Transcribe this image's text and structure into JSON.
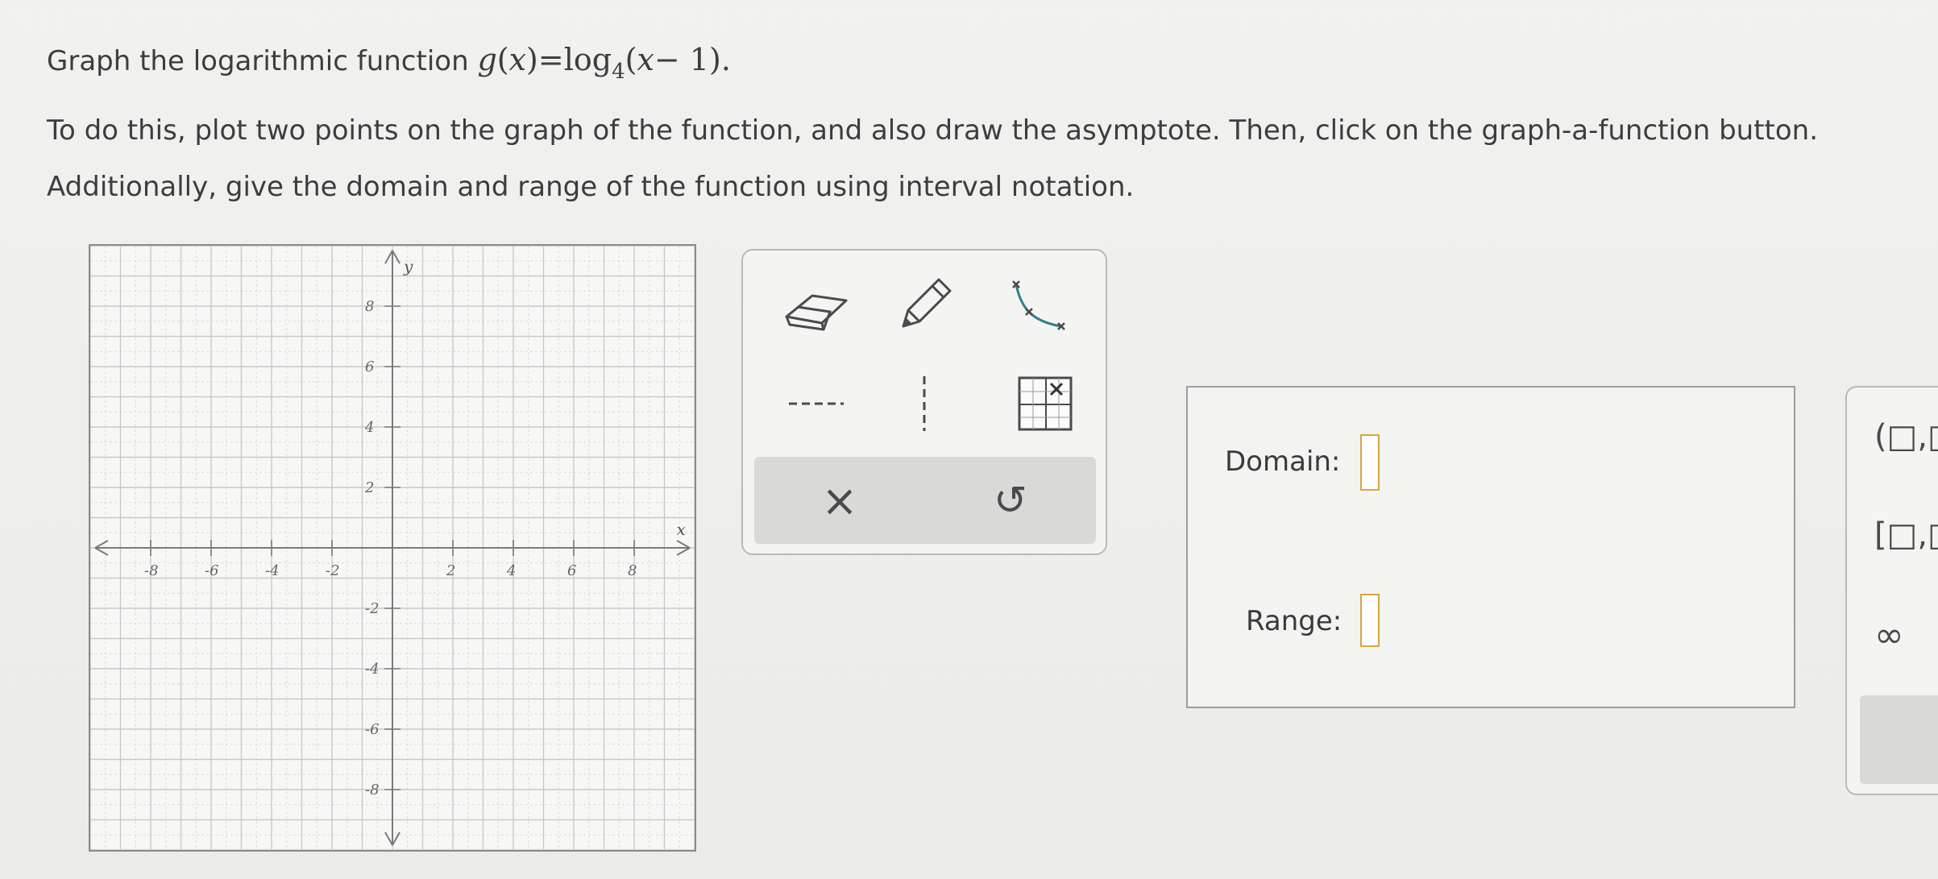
{
  "prompt": {
    "line1_prefix": "Graph the logarithmic function",
    "func_lhs": "g",
    "func_var": "x",
    "func_log": "log",
    "func_base": "4",
    "func_arg": "x",
    "func_minus": "− 1",
    "line2": "To do this, plot two points on the graph of the function, and also draw the asymptote. Then, click on the graph-a-function button.",
    "line3": "Additionally, give the domain and range of the function using interval notation."
  },
  "graph": {
    "x_axis_label": "x",
    "y_axis_label": "y",
    "x_range": [
      -10,
      10
    ],
    "y_range": [
      -10,
      10
    ],
    "x_tick_labels": [
      "-8",
      "-6",
      "-4",
      "-2",
      "2",
      "4",
      "6",
      "8"
    ],
    "y_tick_labels": [
      "8",
      "6",
      "4",
      "2",
      "-2",
      "-4",
      "-6",
      "-8"
    ],
    "grid": true
  },
  "tools": [
    {
      "id": "eraser",
      "icon": "eraser-icon"
    },
    {
      "id": "pencil",
      "icon": "pencil-icon"
    },
    {
      "id": "graph-function",
      "icon": "graph-function-icon"
    },
    {
      "id": "horizontal-asymptote",
      "icon": "horizontal-dashed-line-icon"
    },
    {
      "id": "vertical-asymptote",
      "icon": "vertical-dashed-line-icon"
    },
    {
      "id": "no-solution",
      "icon": "no-solution-grid-icon"
    }
  ],
  "actions": [
    {
      "id": "clear",
      "icon": "x-icon",
      "glyph": "×"
    },
    {
      "id": "undo",
      "icon": "undo-icon",
      "glyph": "↺"
    }
  ],
  "answer": {
    "domain_label": "Domain:",
    "range_label": "Range:",
    "domain_value": "",
    "range_value": ""
  },
  "keypad": {
    "keys": [
      "(□,□",
      "[□,□",
      "∞"
    ]
  },
  "colors": {
    "slot_border": "#d6a640",
    "toolbar_bg": "#d9dad8",
    "icon_teal": "#2f7f8c"
  }
}
